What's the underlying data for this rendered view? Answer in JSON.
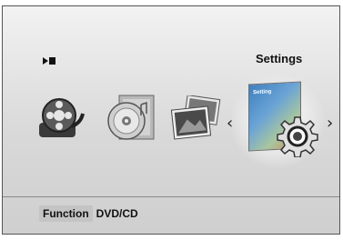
{
  "header": {
    "status_icon": "play-pause-icon",
    "selected_label": "Settings"
  },
  "menu": {
    "items": [
      {
        "name": "video-reel",
        "icon": "film-reel-icon"
      },
      {
        "name": "music-disc",
        "icon": "music-disc-icon"
      },
      {
        "name": "photos",
        "icon": "photos-icon"
      },
      {
        "name": "settings",
        "icon": "settings-gear-icon",
        "card_label": "Setting",
        "selected": true
      }
    ],
    "nav_left": "‹",
    "nav_right": "›"
  },
  "footer": {
    "function_label": "Function",
    "mode_label": "DVD/CD"
  },
  "colors": {
    "background": "#d9d9d9",
    "chip": "#c4c4c4",
    "text": "#111111"
  }
}
